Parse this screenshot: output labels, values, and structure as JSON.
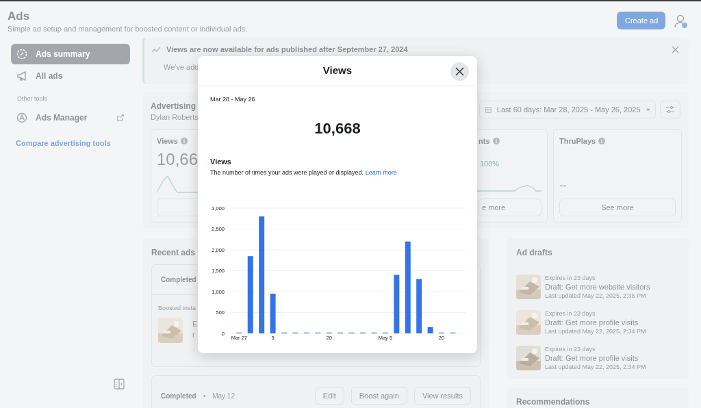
{
  "header": {
    "title": "Ads",
    "subtitle": "Simple ad setup and management for boosted content or individual ads.",
    "create_button": "Create ad"
  },
  "sidebar": {
    "items": [
      {
        "label": "Ads summary",
        "selected": true
      },
      {
        "label": "All ads",
        "selected": false
      }
    ],
    "section_label": "Other tools",
    "tools": [
      {
        "label": "Ads Manager",
        "external": true
      }
    ],
    "compare_link": "Compare advertising tools"
  },
  "banner": {
    "title": "Views are now available for ads published after September 27, 2024",
    "text": "We've add"
  },
  "advertising": {
    "title": "Advertising",
    "subtitle": "Dylan Roberts",
    "date_range": "Last 60 days: Mar 28, 2025 - May 26, 2025",
    "metrics": [
      {
        "label": "Views",
        "value": "10,66",
        "kind": "sparkline"
      },
      {
        "label": "nts",
        "value": "100%",
        "button": "e more",
        "kind": "sparkline"
      },
      {
        "label": "ThruPlays",
        "value": "--",
        "button": "See more",
        "kind": "plain"
      }
    ]
  },
  "recent_ads": {
    "title": "Recent ads",
    "ads": [
      {
        "kind": "partial",
        "status": "Completed",
        "type_label": "Boosted Insta",
        "line_1": "E",
        "line_2": "r"
      },
      {
        "kind": "full",
        "status": "Completed",
        "separator": "•",
        "date": "May 12",
        "buttons": [
          "Edit",
          "Boost again",
          "View results"
        ]
      }
    ]
  },
  "ad_drafts": {
    "title": "Ad drafts",
    "items": [
      {
        "expires": "Expires in 23 days",
        "name": "Draft: Get more website visitors",
        "updated": "Last updated May 22, 2025, 2:36 PM"
      },
      {
        "expires": "Expires in 23 days",
        "name": "Draft: Get more profile visits",
        "updated": "Last updated May 22, 2025, 2:34 PM"
      },
      {
        "expires": "Expires in 23 days",
        "name": "Draft: Get more profile visits",
        "updated": "Last updated May 22, 2025, 2:34 PM"
      }
    ]
  },
  "recommendations": {
    "title": "Recommendations"
  },
  "modal": {
    "title": "Views",
    "range": "Mar 28 - May 26",
    "total": "10,668",
    "section_title": "Views",
    "description": "The number of times your ads were played or displayed.",
    "link": "Learn more",
    "chart_data": {
      "type": "bar",
      "categories": [
        "Mar 27",
        null,
        null,
        "5",
        null,
        null,
        null,
        null,
        "20",
        null,
        null,
        null,
        null,
        "May 5",
        null,
        null,
        null,
        null,
        "20",
        null
      ],
      "series": [
        {
          "color": "#3574e8",
          "values": [
            0,
            1850,
            2800,
            950,
            0,
            0,
            0,
            0,
            0,
            0,
            0,
            0,
            0,
            0,
            1400,
            2200,
            1300,
            150,
            0,
            0
          ]
        }
      ],
      "grid": true,
      "ylim": [
        0,
        3000
      ],
      "yticks": [
        {
          "value": 0,
          "label": "0"
        },
        {
          "value": 500,
          "label": "500"
        },
        {
          "value": 1000,
          "label": "1,000"
        },
        {
          "value": 1500,
          "label": "1,500"
        },
        {
          "value": 2000,
          "label": "2,000"
        },
        {
          "value": 2500,
          "label": "2,500"
        },
        {
          "value": 3000,
          "label": "3,000"
        }
      ]
    }
  }
}
